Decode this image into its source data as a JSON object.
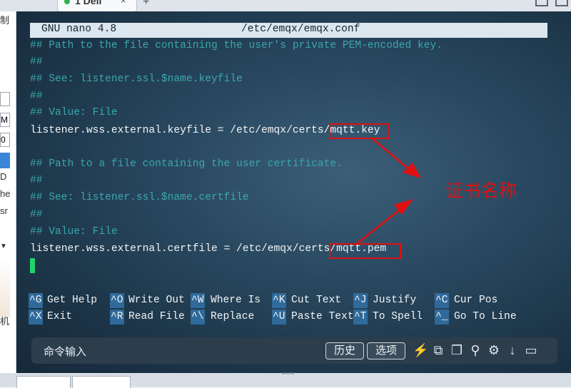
{
  "tabs": {
    "active_label": "1 Dell",
    "close_glyph": "×",
    "add_glyph": "+"
  },
  "left_pane": {
    "frag1": "制",
    "frag2": "M",
    "frag3": "0",
    "frag4": "D",
    "frag5": "he",
    "frag6": "sr",
    "frag7": "机"
  },
  "nano": {
    "header_left": "GNU nano 4.8",
    "header_file": "/etc/emqx/emqx.conf",
    "lines": [
      "## Path to the file containing the user's private PEM-encoded key.",
      "##",
      "## See: listener.ssl.$name.keyfile",
      "##",
      "## Value: File",
      "listener.wss.external.keyfile = /etc/emqx/certs/mqtt.key",
      "",
      "## Path to a file containing the user certificate.",
      "##",
      "## See: listener.ssl.$name.certfile",
      "##",
      "## Value: File",
      "listener.wss.external.certfile = /etc/emqx/certs/mqtt.pem"
    ],
    "shortcuts_row1": [
      {
        "key": "^G",
        "label": "Get Help"
      },
      {
        "key": "^O",
        "label": "Write Out"
      },
      {
        "key": "^W",
        "label": "Where Is"
      },
      {
        "key": "^K",
        "label": "Cut Text"
      },
      {
        "key": "^J",
        "label": "Justify"
      },
      {
        "key": "^C",
        "label": "Cur Pos"
      }
    ],
    "shortcuts_row2": [
      {
        "key": "^X",
        "label": "Exit"
      },
      {
        "key": "^R",
        "label": "Read File"
      },
      {
        "key": "^\\",
        "label": "Replace"
      },
      {
        "key": "^U",
        "label": "Paste Text"
      },
      {
        "key": "^T",
        "label": "To Spell"
      },
      {
        "key": "^_",
        "label": "Go To Line"
      }
    ]
  },
  "annotation": {
    "text": "证书名称",
    "color": "#e01010"
  },
  "command_bar": {
    "placeholder": "命令输入",
    "history_button": "历史",
    "options_button": "选项",
    "icons": [
      "lightning-icon",
      "copy-icon",
      "paste-icon",
      "search-icon",
      "gear-icon",
      "download-icon",
      "window-icon"
    ]
  },
  "colors": {
    "comment": "#3ba7ac",
    "code": "#f2f5f7",
    "cursor": "#1fd36a",
    "keycap": "#2f6a9a"
  }
}
